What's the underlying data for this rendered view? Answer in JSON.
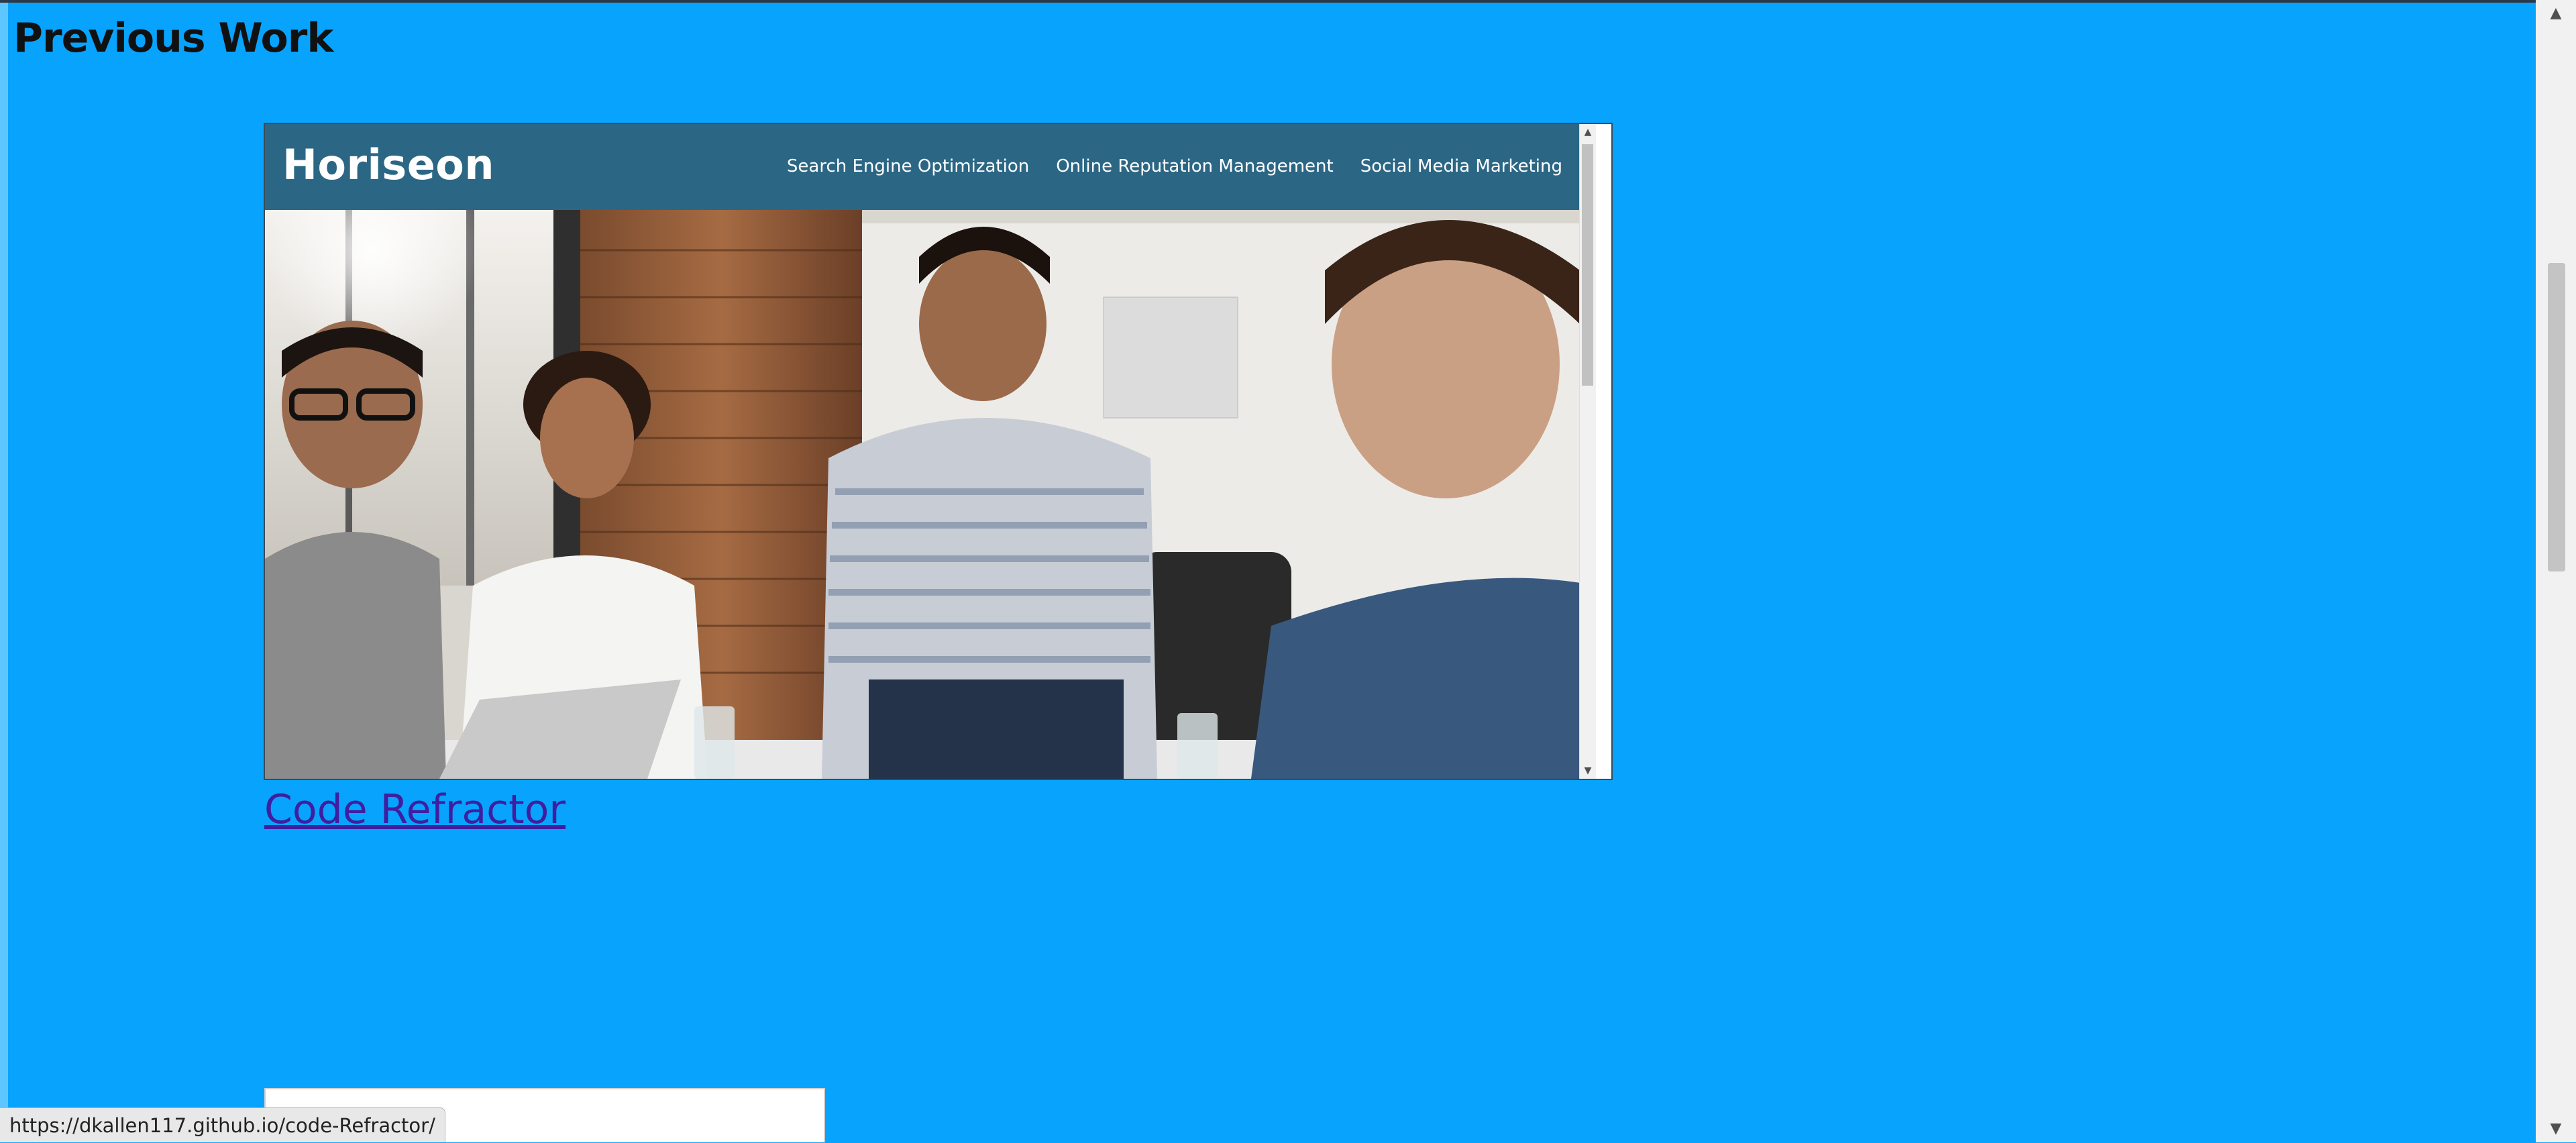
{
  "page": {
    "title": "Previous Work"
  },
  "project": {
    "preview": {
      "brand": "Horiseon",
      "nav": [
        "Search Engine Optimization",
        "Online Reputation Management",
        "Social Media Marketing"
      ]
    },
    "link_label": "Code Refractor"
  },
  "status_bar": {
    "url": "https://dkallen117.github.io/code-Refractor/"
  },
  "colors": {
    "background": "#08a3fd",
    "header": "#2b6784",
    "link": "#3f1ea0"
  },
  "icons": {
    "scroll_up": "triangle-up-icon",
    "scroll_down": "triangle-down-icon"
  }
}
